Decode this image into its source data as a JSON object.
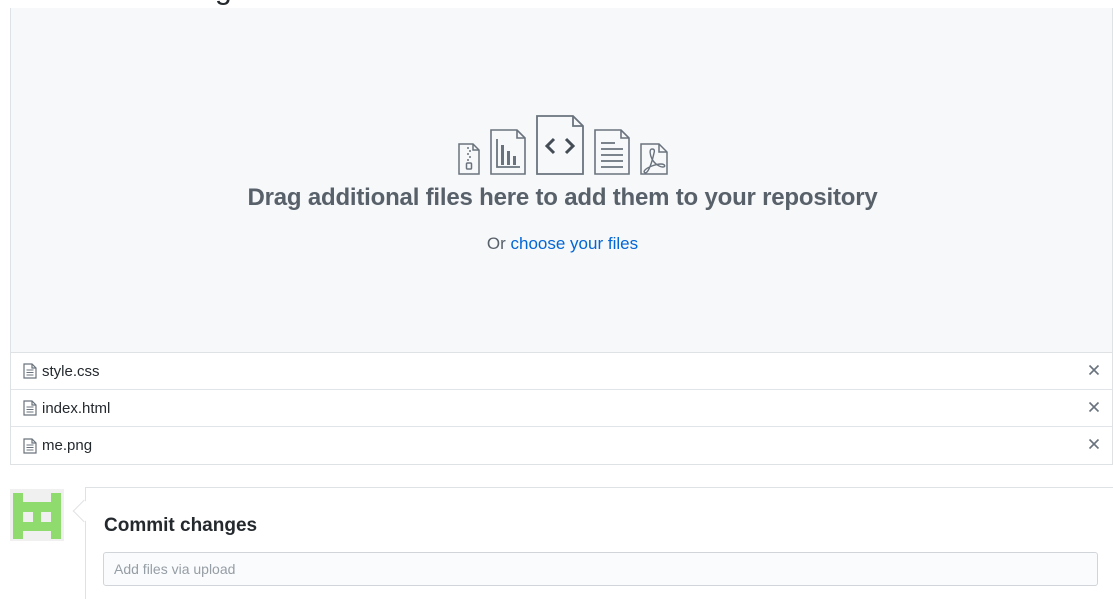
{
  "header_fragment": "g",
  "dropzone": {
    "title": "Drag additional files here to add them to your repository",
    "prefix": "Or",
    "link_label": "choose your files",
    "icons": [
      "zip-file-icon",
      "graph-file-icon",
      "code-file-icon",
      "text-file-icon",
      "pdf-file-icon"
    ]
  },
  "files": [
    {
      "name": "style.css",
      "remove_label": "×"
    },
    {
      "name": "index.html",
      "remove_label": "×"
    },
    {
      "name": "me.png",
      "remove_label": "×"
    }
  ],
  "commit": {
    "title": "Commit changes",
    "placeholder": "Add files via upload"
  },
  "colors": {
    "link": "#0366d6",
    "dropzone_bg": "#f6f8fa",
    "avatar_green": "#8fdb6e"
  }
}
